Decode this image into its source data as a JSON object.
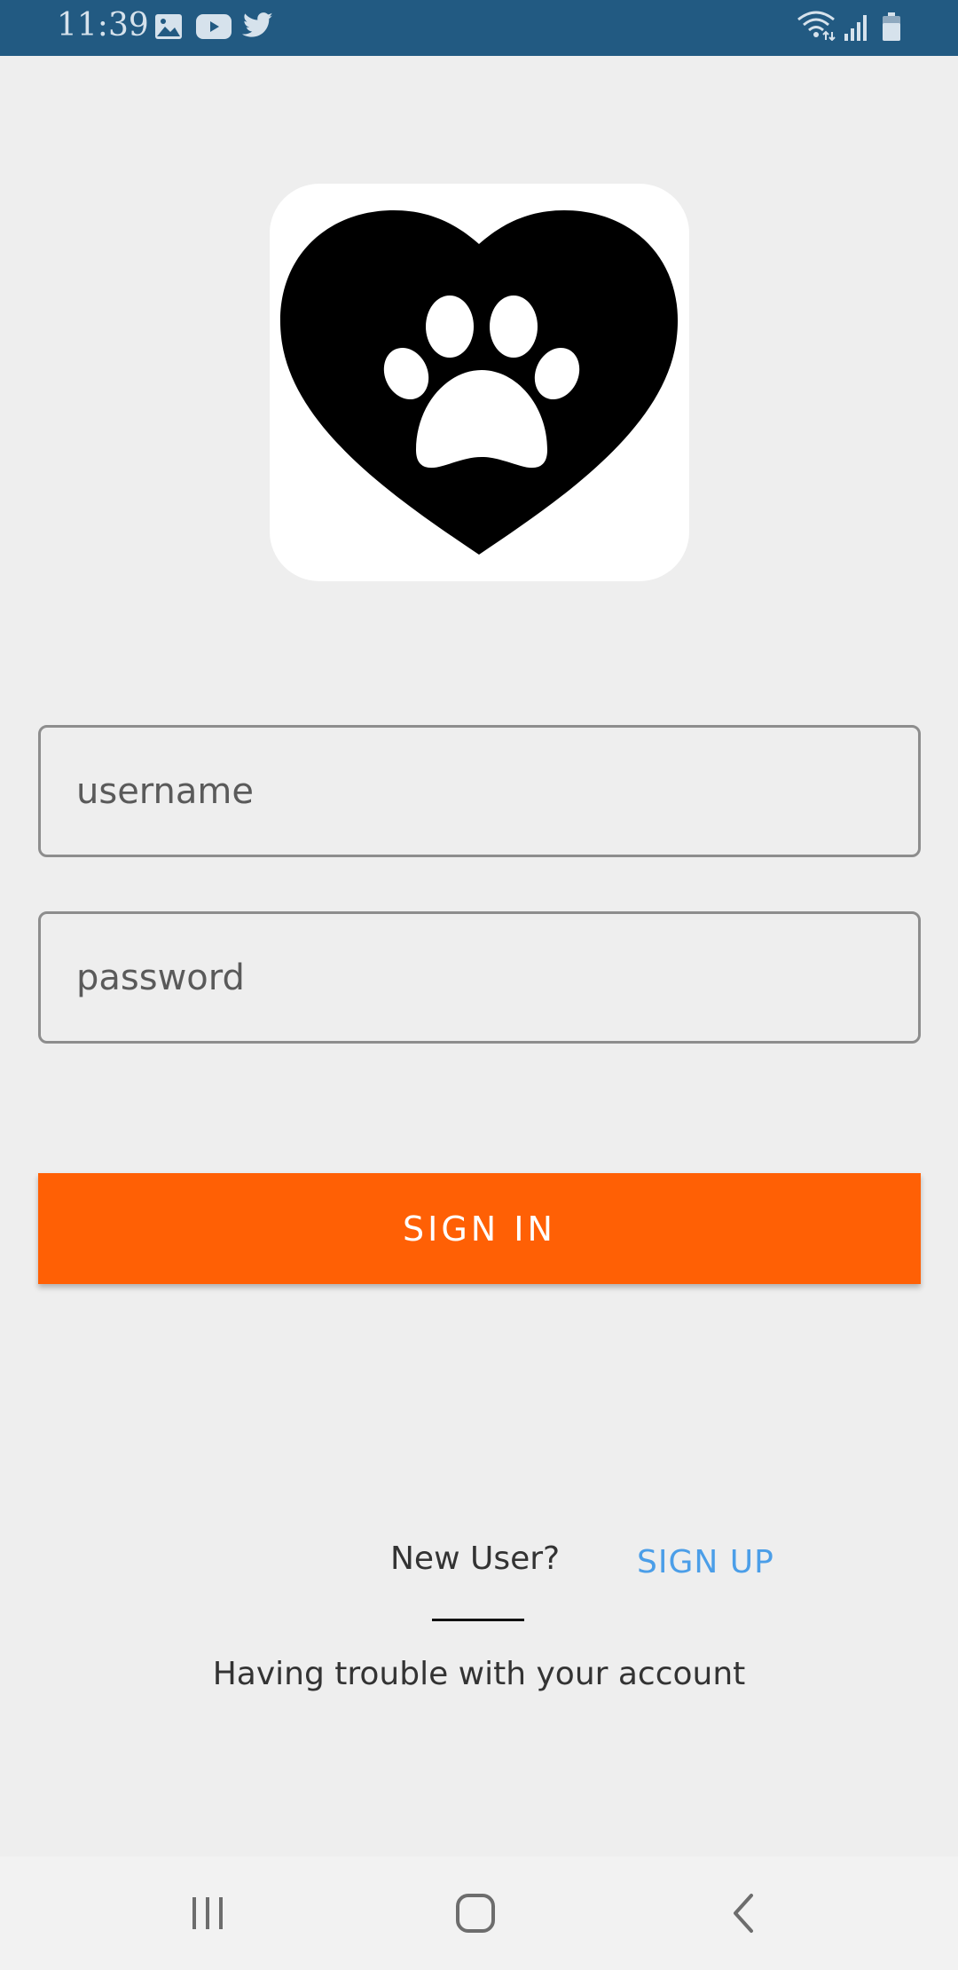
{
  "status_bar": {
    "time": "11:39",
    "icons": [
      "image-icon",
      "youtube-icon",
      "twitter-icon",
      "wifi-icon",
      "signal-icon",
      "battery-icon"
    ],
    "background": "#225a82"
  },
  "logo": {
    "icon": "heart-paw-icon"
  },
  "form": {
    "username_placeholder": "username",
    "password_placeholder": "password",
    "signin_label": "SIGN IN",
    "signin_color": "#ff6005"
  },
  "footer": {
    "new_user": "New User?",
    "signup_label": "SIGN UP",
    "signup_color": "#4b9ee8",
    "trouble": "Having trouble with your account"
  },
  "nav": {
    "icons": [
      "recent-apps-icon",
      "home-icon",
      "back-icon"
    ]
  }
}
